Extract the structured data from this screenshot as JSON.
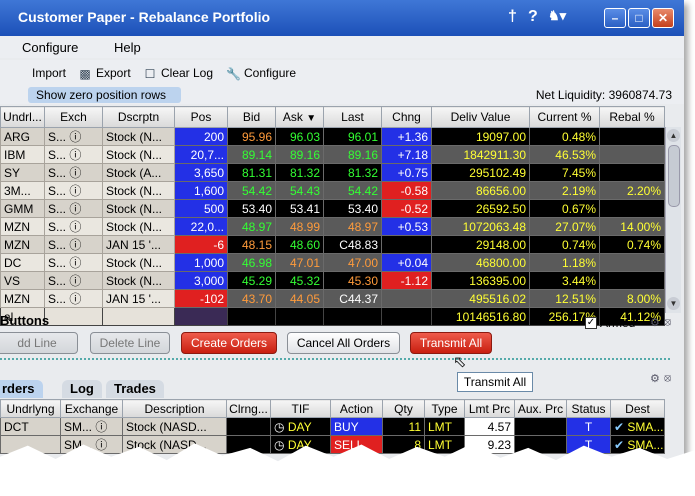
{
  "window": {
    "title": "Customer Paper - Rebalance Portfolio"
  },
  "menu": {
    "items": [
      "Configure",
      "Help"
    ]
  },
  "toolbar": {
    "import_label": "Import",
    "export_label": "Export",
    "clearlog_label": "Clear Log",
    "configure_label": "Configure"
  },
  "options": {
    "zero_rows_label": "Show zero position rows",
    "net_liquidity": "Net Liquidity: 3960874.73"
  },
  "grid": {
    "headers": [
      "Undrl...",
      "Exch",
      "Dscrptn",
      "Pos",
      "Bid",
      "Ask",
      "Last",
      "Chng",
      "Deliv Value",
      "Current %",
      "Rebal %"
    ],
    "rows": [
      {
        "u": "ARG",
        "e": "S...",
        "d": "Stock (N...",
        "pos": "200",
        "bid": "95.96",
        "ask": "96.03",
        "last": "96.01",
        "chng": "+1.36",
        "deliv": "19097.00",
        "cur": "0.48%",
        "reb": ""
      },
      {
        "u": "IBM",
        "e": "S...",
        "d": "Stock (N...",
        "pos": "20,7...",
        "bid": "89.14",
        "ask": "89.16",
        "last": "89.16",
        "chng": "+7.18",
        "deliv": "1842911.30",
        "cur": "46.53%",
        "reb": ""
      },
      {
        "u": "SY",
        "e": "S...",
        "d": "Stock (A...",
        "pos": "3,650",
        "bid": "81.31",
        "ask": "81.32",
        "last": "81.32",
        "chng": "+0.75",
        "deliv": "295102.49",
        "cur": "7.45%",
        "reb": ""
      },
      {
        "u": "3M...",
        "e": "S...",
        "d": "Stock (N...",
        "pos": "1,600",
        "bid": "54.42",
        "ask": "54.43",
        "last": "54.42",
        "chng": "-0.58",
        "deliv": "86656.00",
        "cur": "2.19%",
        "reb": "2.20%"
      },
      {
        "u": "GMM",
        "e": "S...",
        "d": "Stock (N...",
        "pos": "500",
        "bid": "53.40",
        "ask": "53.41",
        "last": "53.40",
        "chng": "-0.52",
        "deliv": "26592.50",
        "cur": "0.67%",
        "reb": ""
      },
      {
        "u": "MZN",
        "e": "S...",
        "d": "Stock (N...",
        "pos": "22,0...",
        "bid": "48.97",
        "ask": "48.99",
        "last": "48.97",
        "chng": "+0.53",
        "deliv": "1072063.48",
        "cur": "27.07%",
        "reb": "14.00%"
      },
      {
        "u": "MZN",
        "e": "S...",
        "d": "JAN 15 '...",
        "pos": "-6",
        "bid": "48.15",
        "ask": "48.60",
        "last": "C48.83",
        "chng": "",
        "deliv": "29148.00",
        "cur": "0.74%",
        "reb": "0.74%"
      },
      {
        "u": "DC",
        "e": "S...",
        "d": "Stock (N...",
        "pos": "1,000",
        "bid": "46.98",
        "ask": "47.01",
        "last": "47.00",
        "chng": "+0.04",
        "deliv": "46800.00",
        "cur": "1.18%",
        "reb": ""
      },
      {
        "u": "VS",
        "e": "S...",
        "d": "Stock (N...",
        "pos": "3,000",
        "bid": "45.29",
        "ask": "45.32",
        "last": "45.30",
        "chng": "-1.12",
        "deliv": "136395.00",
        "cur": "3.44%",
        "reb": ""
      },
      {
        "u": "MZN",
        "e": "S...",
        "d": "JAN 15 '...",
        "pos": "-102",
        "bid": "43.70",
        "ask": "44.05",
        "last": "C44.37",
        "chng": "",
        "deliv": "495516.02",
        "cur": "12.51%",
        "reb": "8.00%"
      }
    ],
    "total": {
      "label": "al",
      "deliv": "10146516.80",
      "cur": "256.17%",
      "reb": "41.12%"
    }
  },
  "buttons_panel": {
    "label": "Buttons",
    "armed_label": "Armed",
    "add_line": "dd Line",
    "delete_line": "Delete Line",
    "create_orders": "Create Orders",
    "cancel_all": "Cancel All Orders",
    "transmit_all": "Transmit All",
    "tooltip": "Transmit All"
  },
  "tabs": [
    "rders",
    "Log",
    "Trades"
  ],
  "orders": {
    "headers": [
      "Undrlyng",
      "Exchange",
      "Description",
      "Clrng...",
      "TIF",
      "Action",
      "Qty",
      "Type",
      "Lmt Prc",
      "Aux. Prc",
      "Status",
      "Dest"
    ],
    "rows": [
      {
        "u": "DCT",
        "e": "SM...",
        "d": "Stock (NASD...",
        "tif": "DAY",
        "act": "BUY",
        "qty": "11",
        "type": "LMT",
        "lmt": "4.57",
        "st": "T",
        "dest": "SMA..."
      },
      {
        "u": "",
        "e": "SM...",
        "d": "Stock (NASD...",
        "tif": "DAY",
        "act": "SELL",
        "qty": "8",
        "type": "LMT",
        "lmt": "9.23",
        "st": "T",
        "dest": "SMA..."
      }
    ]
  },
  "colors": {
    "title_bar": "#2a5fc4",
    "cell_blue": "#2330e6",
    "cell_red": "#e02020",
    "value_yellow": "#ffff33",
    "value_green": "#33ff33",
    "value_orange": "#ff9b3b"
  }
}
